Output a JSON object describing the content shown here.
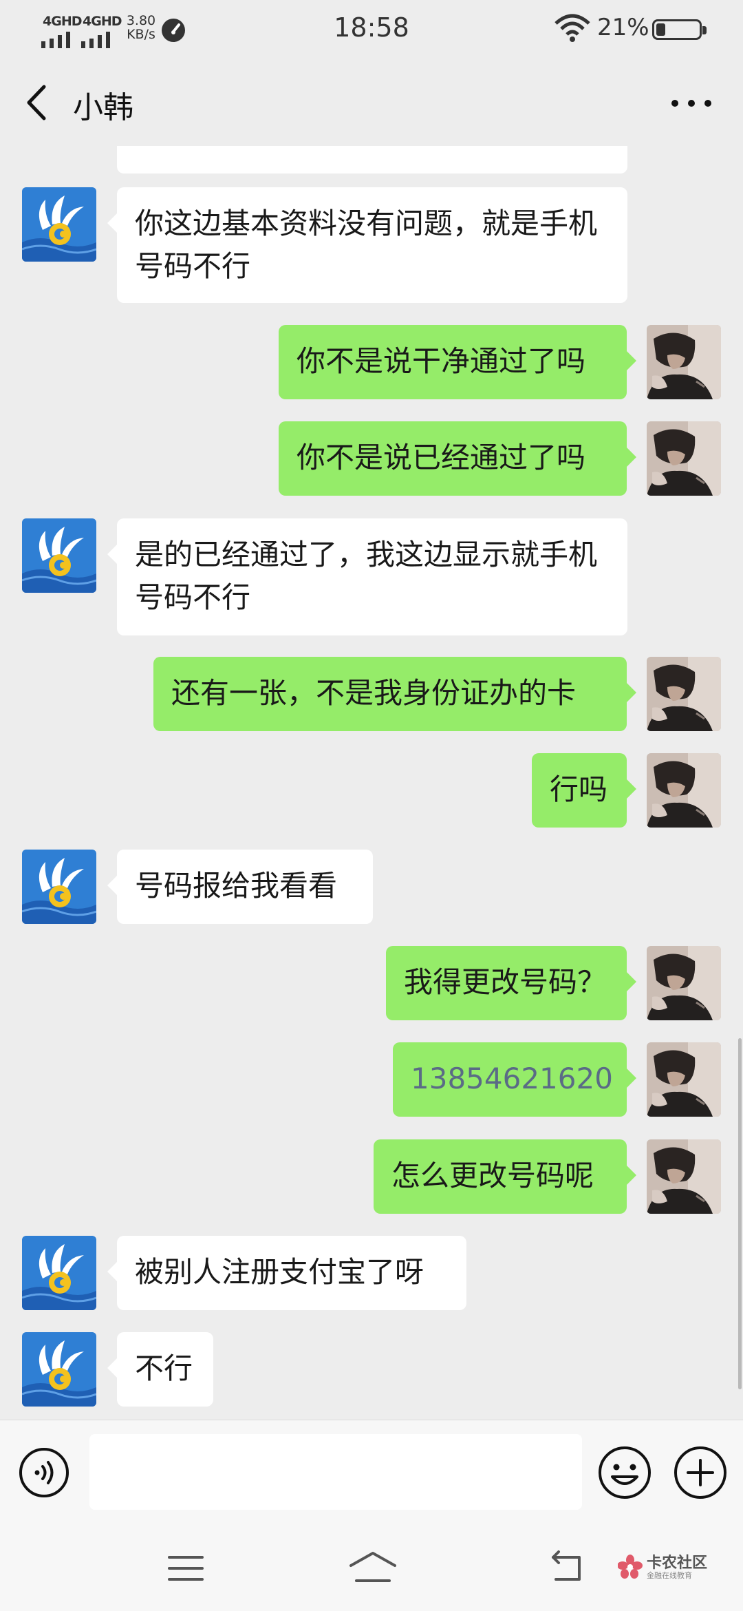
{
  "status_bar": {
    "network_1": "4GHD",
    "network_2": "4GHD",
    "speed_value": "3.80",
    "speed_unit": "KB/s",
    "time": "18:58",
    "battery_percent": "21%",
    "battery_level": 0.21
  },
  "header": {
    "contact_name": "小韩"
  },
  "messages": [
    {
      "from": "contact",
      "text": "你这边基本资料没有问题，就是手机号码不行"
    },
    {
      "from": "me",
      "text": "你不是说干净通过了吗"
    },
    {
      "from": "me",
      "text": "你不是说已经通过了吗"
    },
    {
      "from": "contact",
      "text": "是的已经通过了，我这边显示就手机号码不行"
    },
    {
      "from": "me",
      "text": "还有一张，不是我身份证办的卡"
    },
    {
      "from": "me",
      "text": "行吗"
    },
    {
      "from": "contact",
      "text": "号码报给我看看"
    },
    {
      "from": "me",
      "text": "我得更改号码？"
    },
    {
      "from": "me",
      "text": "13854621620"
    },
    {
      "from": "me",
      "text": "怎么更改号码呢"
    },
    {
      "from": "contact",
      "text": "被别人注册支付宝了呀"
    },
    {
      "from": "contact",
      "text": "不行"
    }
  ],
  "input": {
    "value": ""
  },
  "watermark": {
    "name": "卡农社区",
    "tagline": "金融在线教育"
  },
  "colors": {
    "background": "#ededed",
    "bubble_out": "#95ec69",
    "bubble_in": "#ffffff",
    "phone_link": "#5a6b86"
  },
  "icons": [
    "back-arrow-icon",
    "more-dots-icon",
    "voice-icon",
    "emoji-icon",
    "plus-icon",
    "menu-icon",
    "home-icon",
    "back-icon",
    "wifi-icon",
    "battery-icon"
  ]
}
